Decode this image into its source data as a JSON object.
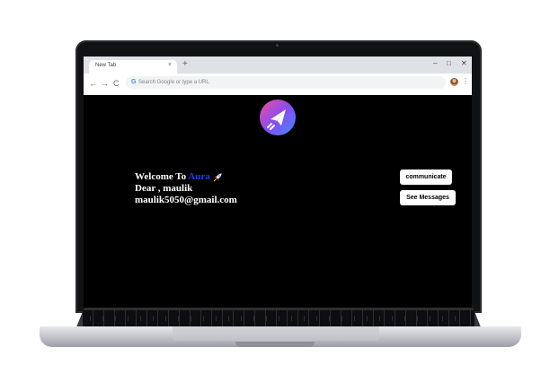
{
  "browser": {
    "tab_title": "New Tab",
    "tab_close": "×",
    "new_tab": "+",
    "window_controls": {
      "minimize": "–",
      "maximize": "□",
      "close": "✕"
    },
    "nav": {
      "back": "←",
      "forward": "→",
      "reload": "C"
    },
    "omnibox": {
      "engine_letter": "G",
      "placeholder": "Search Google or type a URL"
    },
    "menu": "⋮"
  },
  "page": {
    "logo_icon": "paper-plane-icon",
    "welcome_prefix": "Welcome To ",
    "brand_name": "Aura",
    "rocket_icon": "rocket-icon",
    "greeting": "Dear , maulik",
    "email": "maulik5050@gmail.com",
    "buttons": {
      "communicate": "communicate",
      "messages": "See Messages"
    }
  },
  "colors": {
    "screen_bg": "#000000",
    "brand": "#1a3cff",
    "logo_gradient": [
      "#f04f9a",
      "#8a4bf0",
      "#3d8bff"
    ],
    "button_bg": "#ffffff"
  }
}
